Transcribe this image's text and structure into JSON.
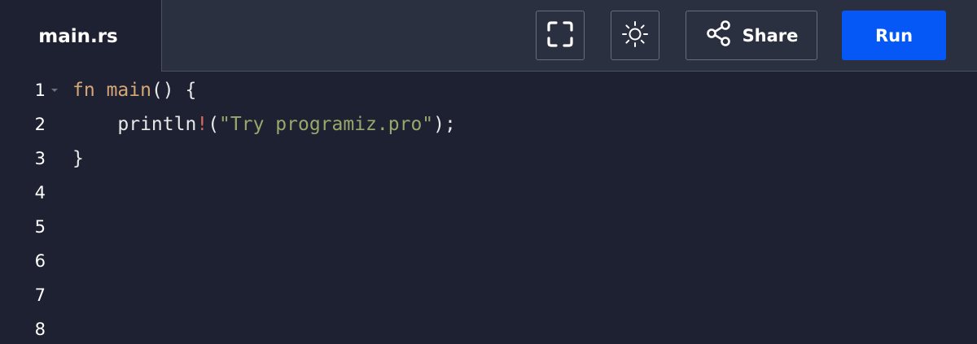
{
  "tab": {
    "filename": "main.rs"
  },
  "toolbar": {
    "fullscreen_icon": "fullscreen-icon",
    "theme_icon": "sun-icon",
    "share_icon": "share-icon",
    "share_label": "Share",
    "run_label": "Run",
    "run_color": "#0557f6"
  },
  "editor": {
    "line_numbers": [
      "1",
      "2",
      "3",
      "4",
      "5",
      "6",
      "7",
      "8"
    ],
    "lines": {
      "l1": {
        "kw": "fn",
        "sp1": " ",
        "name": "main",
        "rest": "() {"
      },
      "l2": {
        "indent": "    ",
        "macro": "println",
        "bang": "!",
        "open": "(",
        "str": "\"Try programiz.pro\"",
        "close": ");"
      },
      "l3": {
        "text": "}"
      }
    }
  }
}
